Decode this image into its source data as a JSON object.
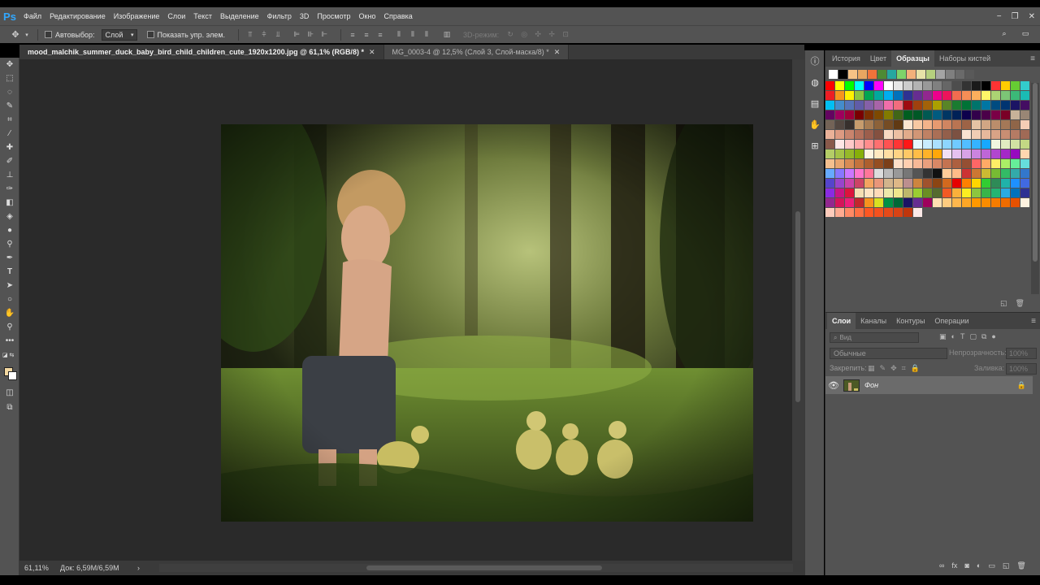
{
  "app": {
    "logo": "Ps",
    "menu": [
      "Файл",
      "Редактирование",
      "Изображение",
      "Слои",
      "Текст",
      "Выделение",
      "Фильтр",
      "3D",
      "Просмотр",
      "Окно",
      "Справка"
    ]
  },
  "window_controls": {
    "minimize": "−",
    "restore": "❐",
    "close": "✕"
  },
  "options": {
    "autoselect_label": "Автовыбор:",
    "autoselect_value": "Слой",
    "show_controls_label": "Показать упр. элем.",
    "mode3d_label": "3D-режим:"
  },
  "tabs": [
    {
      "label": "mood_malchik_summer_duck_baby_bird_child_children_cute_1920x1200.jpg @ 61,1% (RGB/8) *",
      "close": "✕"
    },
    {
      "label": "MG_0003-4 @ 12,5% (Слой 3, Слой-маска/8) *",
      "close": "✕"
    }
  ],
  "status": {
    "zoom": "61,11%",
    "doc_size": "Док: 6,59M/6,59M",
    "arrow": "›"
  },
  "panels": {
    "top_tabs": [
      "История",
      "Цвет",
      "Образцы",
      "Наборы кистей"
    ],
    "layers_tabs": [
      "Слои",
      "Каналы",
      "Контуры",
      "Операции"
    ],
    "layer_search_placeholder": "Вид",
    "blend_mode": "Обычные",
    "opacity_label": "Непрозрачность:",
    "opacity_value": "100%",
    "lock_label": "Закрепить:",
    "fill_label": "Заливка:",
    "fill_value": "100%",
    "layers": [
      {
        "name": "Фон"
      }
    ]
  },
  "colors": {
    "recent": [
      "#ffffff",
      "#000000",
      "#f6c285",
      "#e9a661",
      "#f0733a",
      "#4e8a34",
      "#26a7a0",
      "#7dd36a",
      "#f2b07a",
      "#e7e2a8",
      "#b5cf7e",
      "#a4a4a4",
      "#7f7f7f",
      "#6a6a6a",
      "#595959"
    ],
    "swatches": [
      "#ff0000",
      "#ffff00",
      "#00ff00",
      "#00ffff",
      "#0000ff",
      "#ff00ff",
      "#ffffff",
      "#e6e6e6",
      "#cccccc",
      "#b3b3b3",
      "#999999",
      "#808080",
      "#666666",
      "#4d4d4d",
      "#333333",
      "#1a1a1a",
      "#000000",
      "#ff3333",
      "#ffcc00",
      "#66cc33",
      "#33cccc",
      "#ed1c24",
      "#f7941d",
      "#fff200",
      "#8dc63f",
      "#00a651",
      "#00a99d",
      "#00aeef",
      "#0072bc",
      "#2e3192",
      "#662d91",
      "#92278f",
      "#ec008c",
      "#ed145b",
      "#f26c4f",
      "#f68e56",
      "#fbaf5d",
      "#fff568",
      "#acd373",
      "#7cc576",
      "#3bb878",
      "#1abbb4",
      "#00bff3",
      "#448ccb",
      "#5674b9",
      "#605ca8",
      "#8560a8",
      "#a864a8",
      "#f06eaa",
      "#f26d7d",
      "#9e0b0f",
      "#a0410d",
      "#a36209",
      "#aba000",
      "#598527",
      "#1a7b30",
      "#007236",
      "#00746b",
      "#0076a3",
      "#004b80",
      "#003471",
      "#1b1464",
      "#440e62",
      "#630460",
      "#9e005d",
      "#9e0039",
      "#790000",
      "#7b2e00",
      "#7d4900",
      "#827b00",
      "#406618",
      "#005e20",
      "#005826",
      "#005952",
      "#005b7f",
      "#003663",
      "#002157",
      "#0d004c",
      "#32004b",
      "#4b0049",
      "#7b0046",
      "#7a0026",
      "#c7b299",
      "#998675",
      "#736357",
      "#534741",
      "#37302d",
      "#c69c6d",
      "#a67c52",
      "#8c6239",
      "#754c24",
      "#603913",
      "#fde5d0",
      "#f7c8a2",
      "#f2b38a",
      "#e69a70",
      "#d08561",
      "#b97452",
      "#9d6346",
      "#e5c3a4",
      "#d1a684",
      "#bb8d6b",
      "#a47857",
      "#8f6548",
      "#f5cdb6",
      "#eab198",
      "#dd9a82",
      "#c9846d",
      "#b4705b",
      "#9c5e4c",
      "#845040",
      "#f7d8c2",
      "#ecc0a3",
      "#e1ab8b",
      "#d29676",
      "#c08164",
      "#aa6f56",
      "#935f4b",
      "#7c5142",
      "#f9e3d2",
      "#f1cdb4",
      "#e7b89c",
      "#d9a386",
      "#c98e73",
      "#b57b64",
      "#a06a56",
      "#89594a",
      "#ffe6e6",
      "#ffc9c9",
      "#ffabab",
      "#ff8d8d",
      "#ff7070",
      "#ff5252",
      "#ff3535",
      "#ff1717",
      "#e6f7ff",
      "#c9ecff",
      "#abe0ff",
      "#8dd5ff",
      "#70caff",
      "#52beff",
      "#35b3ff",
      "#17a8ff",
      "#f0f5e0",
      "#e1ebc1",
      "#d2e1a3",
      "#c3d784",
      "#b4cd66",
      "#a5c347",
      "#96b929",
      "#87af0a",
      "#fff4e0",
      "#ffe9c1",
      "#ffdea3",
      "#ffd384",
      "#ffc866",
      "#ffbd47",
      "#ffb229",
      "#ffa70a",
      "#f2e0f7",
      "#e5c1ef",
      "#d8a3e7",
      "#cb84df",
      "#be66d7",
      "#b147cf",
      "#a429c7",
      "#970abf",
      "#ffd7b0",
      "#f5c08e",
      "#e8a66f",
      "#d88b54",
      "#c4733e",
      "#ad5f2e",
      "#954e22",
      "#7b3f19",
      "#ffe0c8",
      "#ffcfb0",
      "#f7b997",
      "#eaa07e",
      "#d98866",
      "#c47351",
      "#ad6040",
      "#954f33",
      "#ff6666",
      "#ffaa66",
      "#ffee66",
      "#aaee66",
      "#66ee99",
      "#66dddd",
      "#66aaff",
      "#8877ff",
      "#cc77ff",
      "#ff77cc",
      "#ff7799",
      "#dddddd",
      "#bbbbbb",
      "#999999",
      "#777777",
      "#555555",
      "#333333",
      "#111111",
      "#ffcc99",
      "#ffbb88",
      "#cc3333",
      "#cc7733",
      "#ccbb33",
      "#77bb33",
      "#33bb66",
      "#33aaaa",
      "#3377cc",
      "#5544cc",
      "#9944cc",
      "#cc44aa",
      "#cc4466",
      "#f4a460",
      "#e9967a",
      "#d2b48c",
      "#deb887",
      "#bc8f8f",
      "#cd853f",
      "#a0522d",
      "#8b4513",
      "#d2691e",
      "#e60000",
      "#ff8000",
      "#ffd700",
      "#32cd32",
      "#2e8b57",
      "#20b2aa",
      "#1e90ff",
      "#4169e1",
      "#8a2be2",
      "#c71585",
      "#dc143c",
      "#f5deb3",
      "#ffe4c4",
      "#ffdab9",
      "#eee8aa",
      "#f0e68c",
      "#bdb76b",
      "#9acd32",
      "#6b8e23",
      "#556b2f",
      "#f15a24",
      "#fbb03b",
      "#fcee21",
      "#8cc63f",
      "#39b54a",
      "#22b573",
      "#29abe2",
      "#0071bc",
      "#2e3192",
      "#93278f",
      "#d4145a",
      "#ed1e79",
      "#c1272d",
      "#f7931e",
      "#d9e021",
      "#009245",
      "#006837",
      "#1b1464",
      "#662d91",
      "#9e005d",
      "#ffe0b2",
      "#ffcc80",
      "#ffb74d",
      "#ffa726",
      "#ff9800",
      "#fb8c00",
      "#f57c00",
      "#ef6c00",
      "#e65100",
      "#fff3e0",
      "#ffccbc",
      "#ffab91",
      "#ff8a65",
      "#ff7043",
      "#ff5722",
      "#f4511e",
      "#e64a19",
      "#d84315",
      "#bf360c",
      "#fbe9e7"
    ]
  }
}
